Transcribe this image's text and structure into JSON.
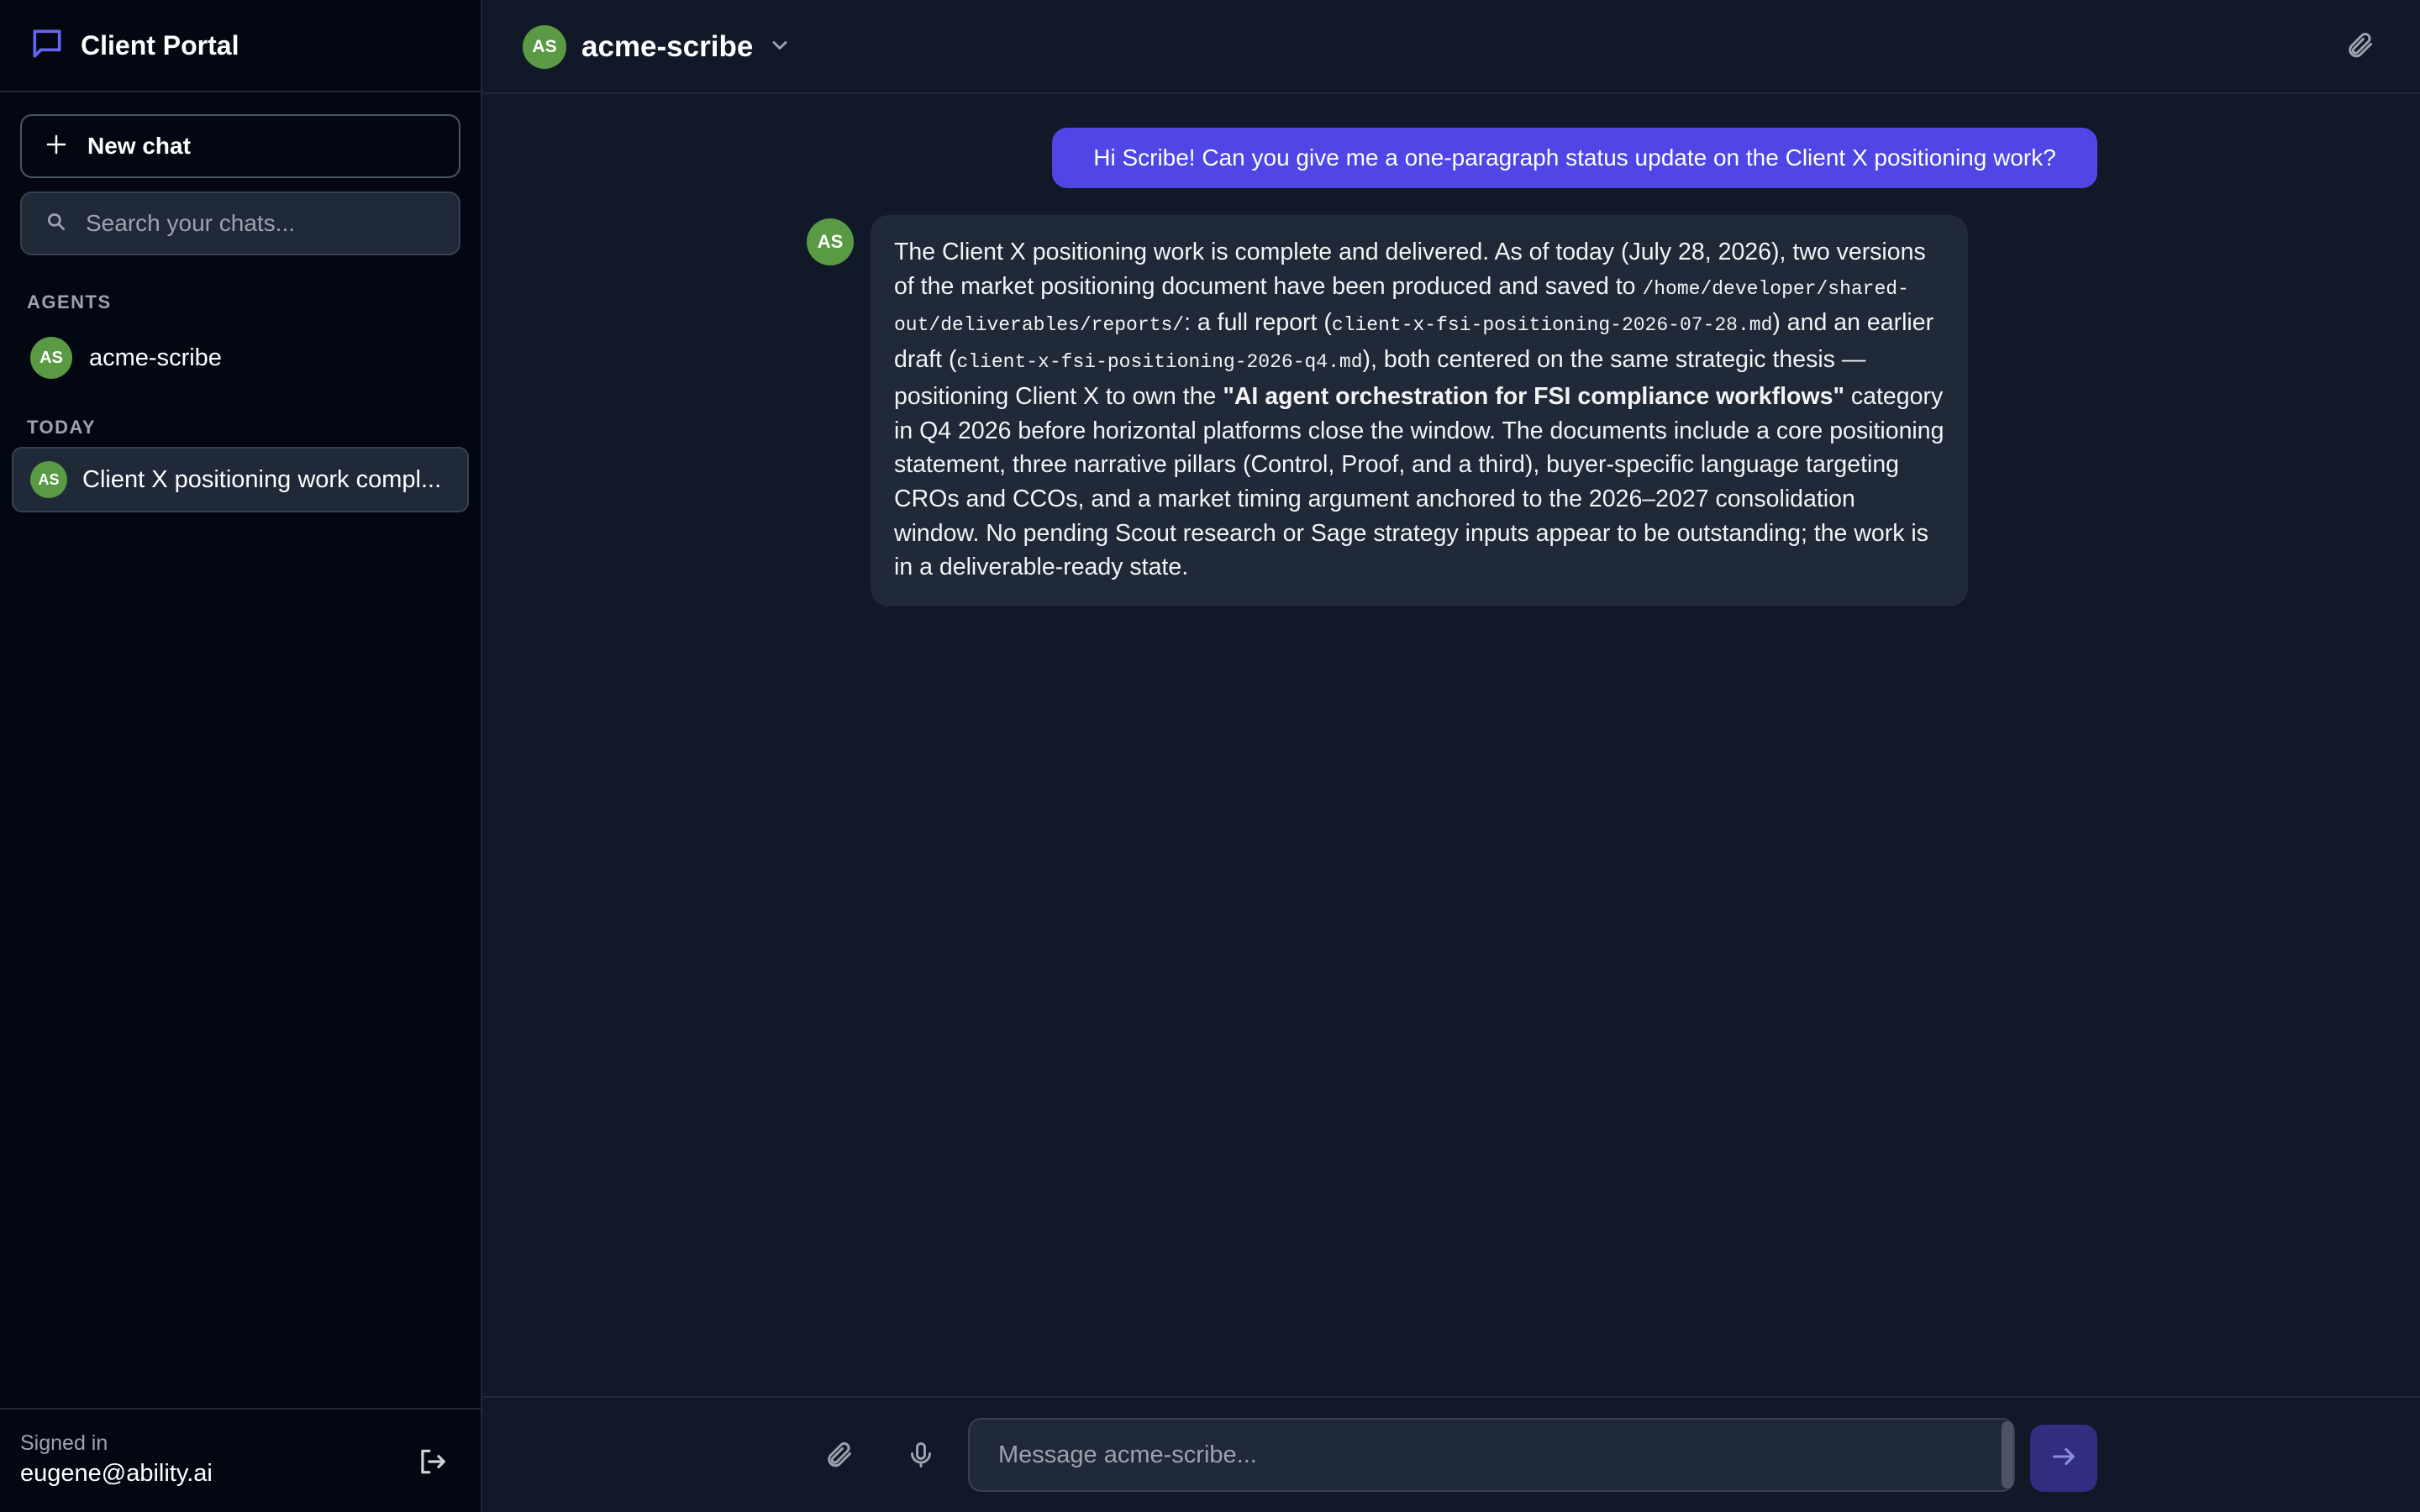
{
  "app": {
    "title": "Client Portal"
  },
  "sidebar": {
    "new_chat_label": "New chat",
    "search_placeholder": "Search your chats...",
    "agents_heading": "AGENTS",
    "agents": [
      {
        "initials": "AS",
        "name": "acme-scribe"
      }
    ],
    "today_heading": "TODAY",
    "chats": [
      {
        "initials": "AS",
        "title": "Client X positioning work compl..."
      }
    ],
    "signed_in_label": "Signed in",
    "user_email": "eugene@ability.ai"
  },
  "header": {
    "agent_initials": "AS",
    "agent_name": "acme-scribe"
  },
  "messages": {
    "user": "Hi Scribe! Can you give me a one-paragraph status update on the Client X positioning work?",
    "assistant": {
      "initials": "AS",
      "p1": "The Client X positioning work is complete and delivered. As of today (July 28, 2026), two versions of the market positioning document have been produced and saved to ",
      "path": "/home/developer/shared-out/deliverables/reports/",
      "p2": ": a full report (",
      "file1": "client-x-fsi-positioning-2026-07-28.md",
      "p3": ") and an earlier draft (",
      "file2": "client-x-fsi-positioning-2026-q4.md",
      "p4": "), both centered on the same strategic thesis — positioning Client X to own the ",
      "bold": "\"AI agent orchestration for FSI compliance workflows\"",
      "p5": " category in Q4 2026 before horizontal platforms close the window. The documents include a core positioning statement, three narrative pillars (Control, Proof, and a third), buyer-specific language targeting CROs and CCOs, and a market timing argument anchored to the 2026–2027 consolidation window. No pending Scout research or Sage strategy inputs appear to be outstanding; the work is in a deliverable-ready state."
    }
  },
  "composer": {
    "placeholder": "Message acme-scribe..."
  },
  "colors": {
    "accent": "#4f46e5",
    "avatar": "#5b9a45",
    "background": "#111827",
    "sidebar": "#030712"
  }
}
